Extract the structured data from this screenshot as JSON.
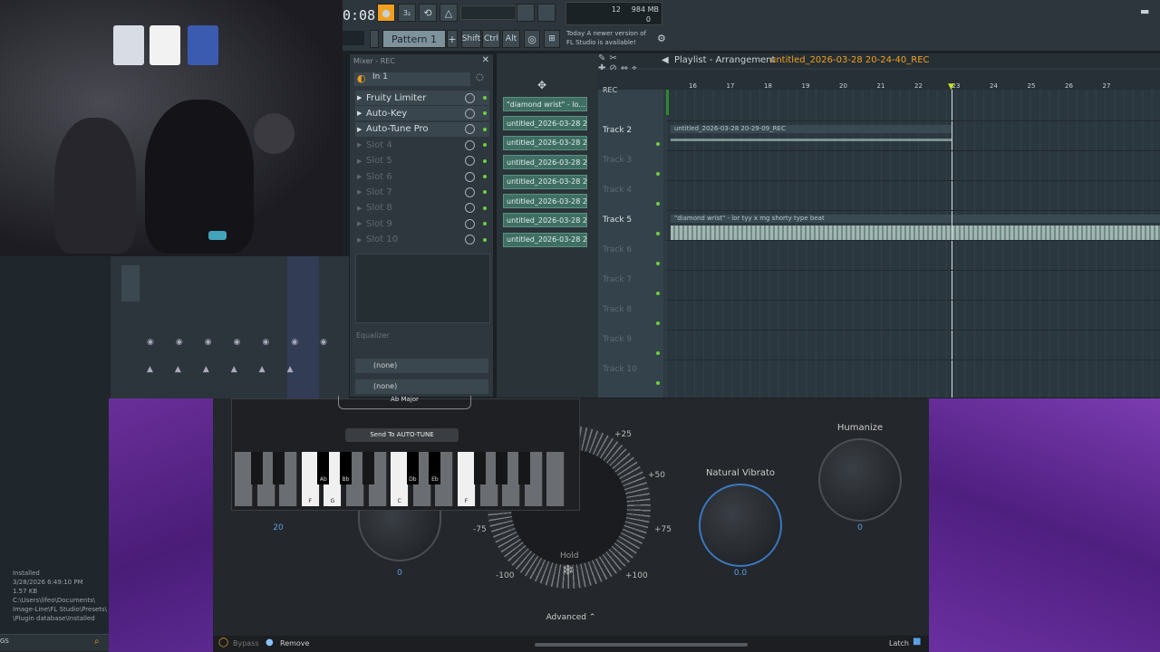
{
  "toolbar": {
    "time": "0:08",
    "pattern": "Pattern 1",
    "shift": "Shift",
    "ctrl": "Ctrl",
    "alt": "Alt",
    "cpu_value": "12",
    "memory": "984 MB",
    "memory_sub": "0",
    "news_line1": "Today  A newer version of",
    "news_line2": "FL Studio is available!"
  },
  "mixer": {
    "title": "Mixer - REC",
    "input": "In 1",
    "slots": [
      {
        "label": "Fruity Limiter",
        "enabled": true
      },
      {
        "label": "Auto-Key",
        "enabled": true
      },
      {
        "label": "Auto-Tune Pro",
        "enabled": true
      },
      {
        "label": "Slot 4",
        "enabled": false
      },
      {
        "label": "Slot 5",
        "enabled": false
      },
      {
        "label": "Slot 6",
        "enabled": false
      },
      {
        "label": "Slot 7",
        "enabled": false
      },
      {
        "label": "Slot 8",
        "enabled": false
      },
      {
        "label": "Slot 9",
        "enabled": false
      },
      {
        "label": "Slot 10",
        "enabled": false
      }
    ],
    "equalizer": "Equalizer",
    "send1": "(none)",
    "send2": "(none)"
  },
  "picker": {
    "clips": [
      "\"diamond wrist\" - lo...",
      "untitled_2026-03-28 20-...",
      "untitled_2026-03-28 20-...",
      "untitled_2026-03-28 20-...",
      "untitled_2026-03-28 20-...",
      "untitled_2026-03-28 20-...",
      "untitled_2026-03-28 20-...",
      "untitled_2026-03-28 20-..."
    ]
  },
  "playlist": {
    "title": "Playlist - Arrangement",
    "project": "untitled_2026-03-28 20-24-40_REC",
    "ruler": [
      "16",
      "17",
      "18",
      "19",
      "20",
      "21",
      "22",
      "23",
      "24",
      "25",
      "26",
      "27"
    ],
    "rec_label": "REC",
    "tracks": [
      "Track 2",
      "Track 3",
      "Track 4",
      "Track 5",
      "Track 6",
      "Track 7",
      "Track 8",
      "Track 9",
      "Track 10"
    ],
    "clip_track2": "untitled_2026-03-28 20-29-09_REC",
    "clip_track5": "\"diamond wrist\" - lor tyy x mg shorty type beat"
  },
  "autotune": {
    "key_display": "Ab Major",
    "send_button": "Send To AUTO-TUNE",
    "keys_black": [
      "Ab",
      "Bb",
      "Db",
      "Eb"
    ],
    "keys_white": [
      "F",
      "G",
      "C",
      "F"
    ],
    "humanize_label": "Humanize",
    "humanize_value": "0",
    "vibrato_label": "Natural Vibrato",
    "vibrato_value": "0.0",
    "left_value": "20",
    "mid_value": "0",
    "dial_plus25": "+25",
    "dial_plus50": "+50",
    "dial_plus75": "+75",
    "dial_plus100": "+100",
    "dial_minus75": "-75",
    "dial_minus100": "-100",
    "hold": "Hold",
    "advanced": "Advanced",
    "bypass": "Bypass",
    "remove": "Remove",
    "latch": "Latch"
  },
  "file_info": [
    "Installed",
    "3/28/2026 6:49:10 PM",
    "1.57 KB",
    "C:\\Users\\lifeo\\Documents\\",
    "Image-Line\\FL Studio\\Presets\\",
    "\\Plugin database\\Installed"
  ],
  "colors": {
    "accent_orange": "#f0a020",
    "clip_green": "#3f6e63",
    "purple_bg": "#5b2990",
    "link_blue": "#5aa0e6"
  }
}
